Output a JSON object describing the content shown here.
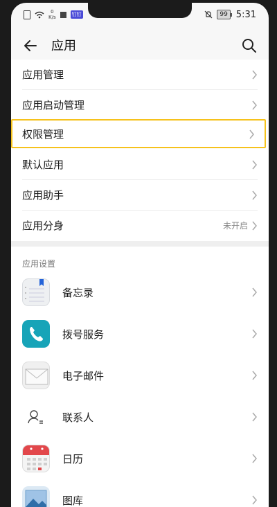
{
  "status_bar": {
    "net_speed_top": "0",
    "net_speed_bottom": "K/s",
    "app_badge": "钉钉",
    "battery": "99",
    "time": "5:31"
  },
  "header": {
    "title": "应用"
  },
  "menu": {
    "items": [
      {
        "label": "应用管理"
      },
      {
        "label": "应用启动管理"
      },
      {
        "label": "权限管理"
      },
      {
        "label": "默认应用"
      },
      {
        "label": "应用助手"
      },
      {
        "label": "应用分身",
        "value": "未开启"
      }
    ]
  },
  "settings": {
    "section_title": "应用设置",
    "apps": [
      {
        "label": "备忘录",
        "icon": "notepad-icon"
      },
      {
        "label": "拨号服务",
        "icon": "phone-icon"
      },
      {
        "label": "电子邮件",
        "icon": "mail-icon"
      },
      {
        "label": "联系人",
        "icon": "contacts-icon"
      },
      {
        "label": "日历",
        "icon": "calendar-icon"
      },
      {
        "label": "图库",
        "icon": "gallery-icon"
      }
    ]
  },
  "colors": {
    "highlight": "#f6c21c",
    "phone_app": "#17a4b8",
    "calendar_red": "#e2474b",
    "bookmark_blue": "#2463d8"
  }
}
